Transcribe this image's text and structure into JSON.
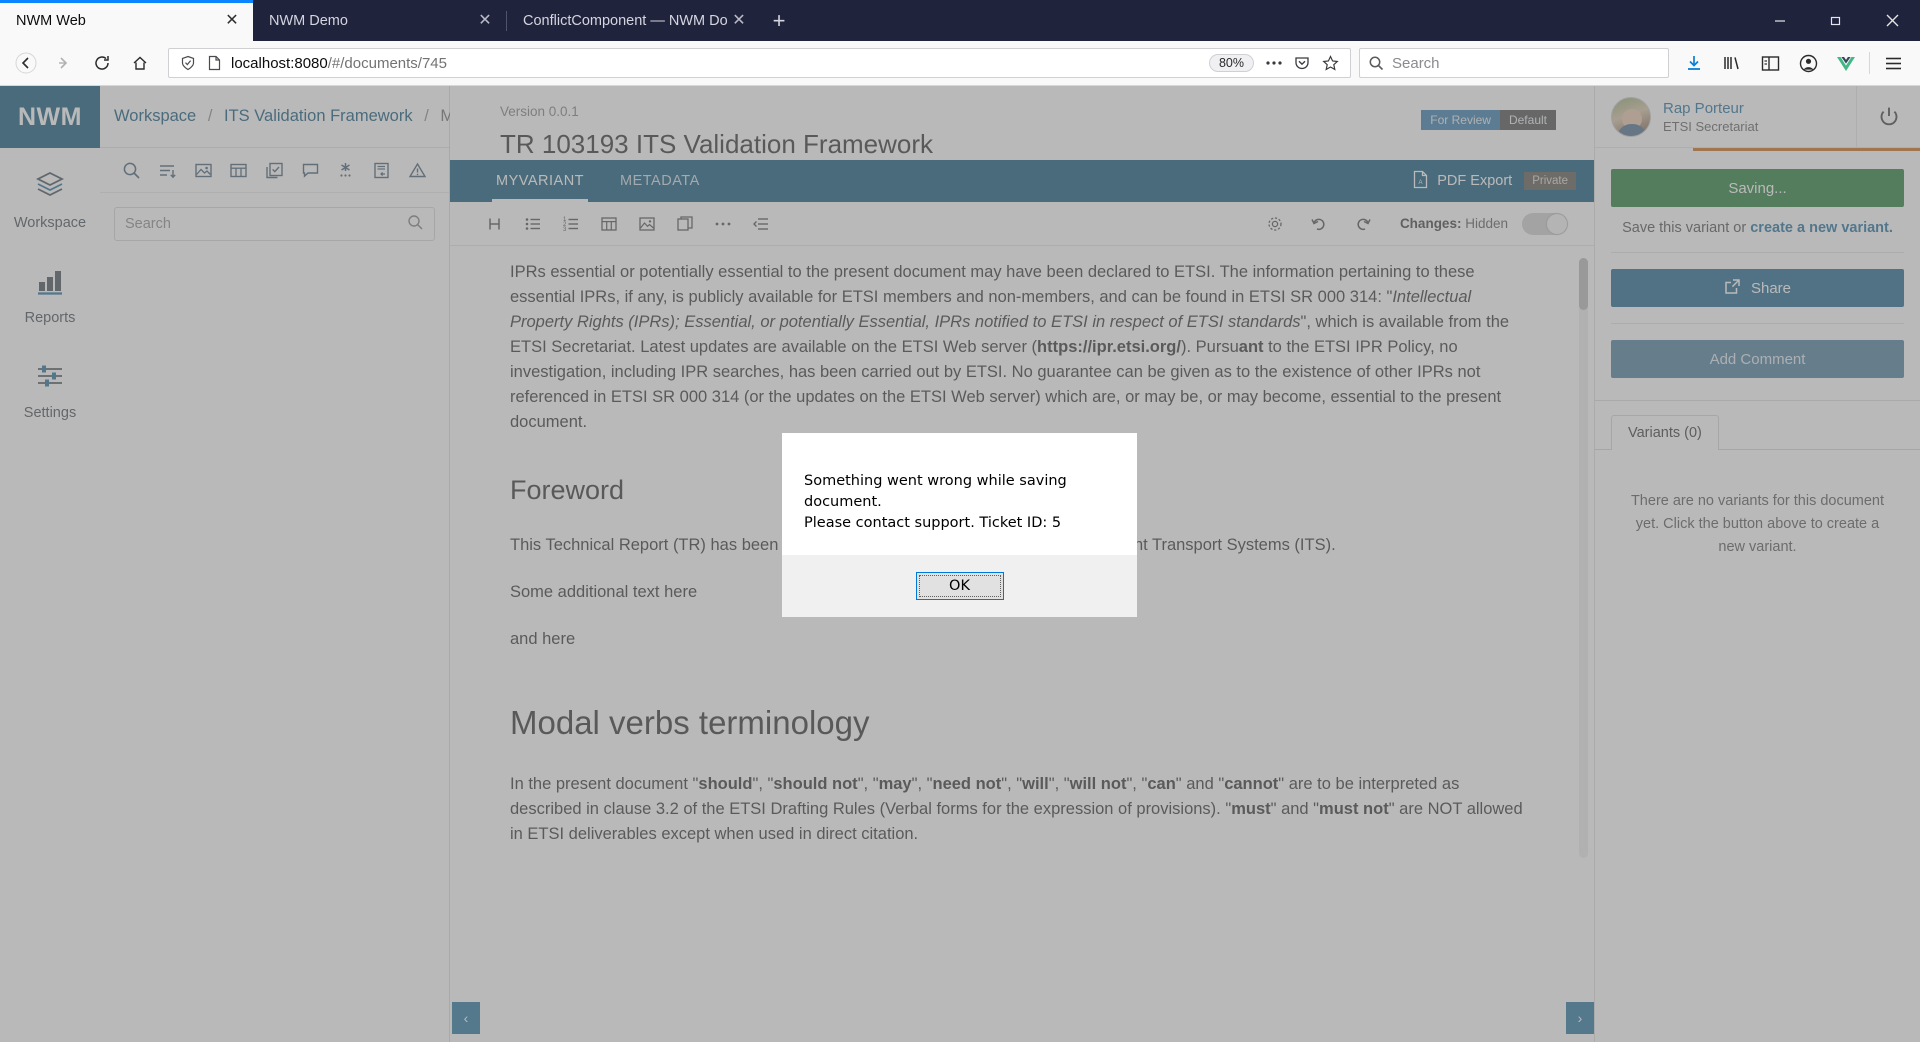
{
  "browser": {
    "tabs": [
      {
        "title": "NWM Web",
        "active": true
      },
      {
        "title": "NWM Demo",
        "active": false
      },
      {
        "title": "ConflictComponent — NWM Docu",
        "active": false
      }
    ],
    "new_tab_label": "+",
    "close_label": "✕",
    "window_controls": {
      "minimize": "—",
      "maximize": "❐",
      "close": "✕"
    },
    "nav": {
      "back": "←",
      "forward": "→",
      "reload": "⟳",
      "home": "⌂"
    },
    "url": {
      "host": "localhost:8080",
      "path": "/#/documents/745"
    },
    "zoom_level": "80%",
    "search": {
      "placeholder": "Search"
    },
    "icons": {
      "shield": "shield-icon",
      "page": "page-icon",
      "ellipsis": "…",
      "pocket": "pocket-icon",
      "bookmark": "star-icon",
      "download": "download-icon",
      "library": "library-icon",
      "sidebar": "sidebar-icon",
      "account": "account-icon",
      "vue": "V",
      "menu": "hamburger-icon"
    }
  },
  "app": {
    "logo": "NWM",
    "rail": [
      {
        "label": "Workspace",
        "icon": "layers-icon"
      },
      {
        "label": "Reports",
        "icon": "bar-chart-icon"
      },
      {
        "label": "Settings",
        "icon": "sliders-icon"
      }
    ],
    "breadcrumb": {
      "root": "Workspace",
      "sep": "/",
      "middle": "ITS Validation Framework",
      "current": "MyVariant"
    },
    "panel_tools": [
      "search-icon",
      "list-sort-icon",
      "image-icon",
      "table-icon",
      "checkbox-doc-icon",
      "comment-icon",
      "asterisk-icon",
      "doc-reply-icon",
      "warning-triangle-icon"
    ],
    "panel_search": {
      "placeholder": "Search",
      "icon": "search-icon"
    },
    "help_icon": "help-circle-icon",
    "bell_icon": "bell-icon"
  },
  "document": {
    "version": "Version 0.0.1",
    "title": "TR 103193 ITS Validation Framework",
    "badges": [
      {
        "label": "For Review",
        "color": "#2f78a8"
      },
      {
        "label": "Default",
        "color": "#4a4a4a"
      }
    ],
    "tabs": [
      {
        "label": "MYVARIANT",
        "active": true
      },
      {
        "label": "METADATA",
        "active": false
      }
    ],
    "pdf_export": "PDF Export",
    "pdf_icon": "pdf-icon",
    "private_badge": "Private",
    "toolbar": {
      "items": [
        "heading-icon",
        "bullet-list-icon",
        "numbered-list-icon",
        "table-icon",
        "image-icon",
        "copy-icon",
        "more-icon",
        "indent-icon"
      ],
      "settings_icon": "gear-icon",
      "undo_icon": "undo-icon",
      "redo_icon": "redo-icon",
      "changes_label": "Changes:",
      "changes_value": "Hidden"
    },
    "body": {
      "para1_a": "IPRs essential or potentially essential to the present document may have been declared to ETSI. The information pertaining to these essential IPRs, if any, is publicly available for ",
      "para1_b": "ETSI members and non-members",
      "para1_c": ", and can be found in ETSI SR 000 314: \"",
      "para1_italic": "Intellectual Property Rights (IPRs); Essential, or potentially Essential, IPRs notified to ETSI in respect of ETSI standards",
      "para1_d": "\", which is available from the ETSI Secretariat. Latest updates are available on the ETSI Web server (",
      "para1_link": "https://ipr.etsi.org/",
      "para1_e": "). Pursu",
      "para1_bold": "ant",
      "para1_f": " to the ETSI IPR Policy, no investigation, including IPR searches, has been carried out by ETSI. No guarantee can be given as to the existence of other IPRs not referenced in ETSI SR 000 314 (or the updates on the ETSI Web server) which are, or may be, or may become, essential to the present document.",
      "heading_foreword": "Foreword",
      "para2": "This Technical Report (TR) has been produced by ETSI Technical Committee Intelligent Transport Systems (ITS).",
      "para3": "Some additional text here",
      "para4": "and here",
      "heading_modal": "Modal verbs terminology",
      "para5_a": "In the present document \"",
      "t_should": "should",
      "t_should_not": "should not",
      "t_may": "may",
      "t_need_not": "need not",
      "t_will": "will",
      "t_will_not": "will not",
      "t_can": "can",
      "t_cannot": "cannot",
      "para5_b": "\" are to be interpreted as described in clause 3.2 of the ETSI Drafting Rules (Verbal forms for the expression of provisions). \"",
      "t_must": "must",
      "para5_c": "\" and \"",
      "t_must_not": "must not",
      "para5_d": "\" are NOT allowed in ETSI deliverables except when used in direct citation."
    },
    "nav_prev": "‹",
    "nav_next": "›"
  },
  "user": {
    "name": "Rap Porteur",
    "role": "ETSI Secretariat",
    "power_icon": "power-icon",
    "avatar": "avatar"
  },
  "right_panel": {
    "save_button": "Saving...",
    "save_hint_prefix": "Save this variant or ",
    "save_hint_link": "create a new variant.",
    "share_button": "Share",
    "share_icon": "external-link-icon",
    "add_comment_button": "Add Comment",
    "variants_tab": "Variants (0)",
    "variants_empty": "There are no variants for this document yet. Click the button above to create a new variant."
  },
  "modal": {
    "line1": "Something went wrong while saving document.",
    "line2": "Please contact support. Ticket ID: 5",
    "ok_button": "OK"
  },
  "colors": {
    "brand": "#0b5378",
    "accent_orange": "#c96a12",
    "save_green": "#1d7a33",
    "share_blue": "#196289",
    "tab_dark": "#20233c"
  }
}
